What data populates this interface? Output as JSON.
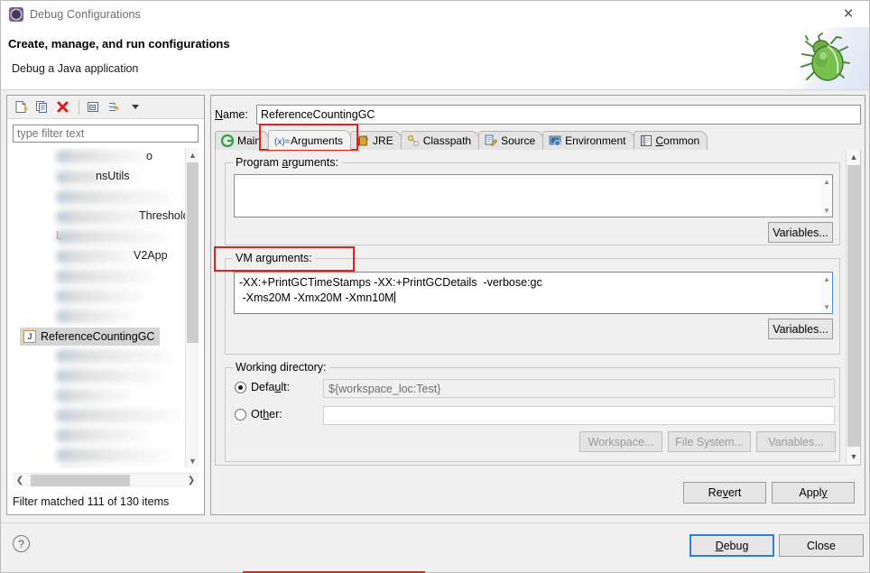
{
  "window": {
    "title": "Debug Configurations",
    "icon": "gear-icon",
    "close_label": "✕"
  },
  "header": {
    "title": "Create, manage, and run configurations",
    "subtitle": "Debug a Java application",
    "art_icon": "green-bug-icon"
  },
  "left_panel": {
    "toolbar": [
      {
        "name": "new-configuration-icon",
        "tooltip": "New launch configuration"
      },
      {
        "name": "duplicate-configuration-icon",
        "tooltip": "Duplicate"
      },
      {
        "name": "delete-configuration-icon",
        "tooltip": "Delete"
      },
      {
        "name": "collapse-all-icon",
        "tooltip": "Collapse All"
      },
      {
        "name": "filter-icon",
        "tooltip": "Filter launch configurations"
      },
      {
        "name": "view-menu-caret-icon",
        "tooltip": "View Menu"
      }
    ],
    "filter": {
      "value": "",
      "placeholder": "type filter text"
    },
    "tree": {
      "visible_fragments": [
        "o",
        "nsUtils",
        "Threshold",
        "L",
        "V2App"
      ],
      "selected_item": {
        "label": "ReferenceCountingGC",
        "icon": "java-application-icon",
        "icon_letter": "J"
      }
    },
    "status": "Filter matched 111 of 130 items"
  },
  "config": {
    "name_label": "Name:",
    "name_label_mnemonic": "N",
    "name_value": "ReferenceCountingGC",
    "tabs": [
      {
        "label": "Main",
        "icon": "main-tab-icon",
        "active": false,
        "mnemonic": ""
      },
      {
        "label": "Arguments",
        "icon": "arguments-tab-icon",
        "active": true,
        "mnemonic": ""
      },
      {
        "label": "JRE",
        "icon": "jre-tab-icon",
        "active": false,
        "mnemonic": ""
      },
      {
        "label": "Classpath",
        "icon": "classpath-tab-icon",
        "active": false,
        "mnemonic": ""
      },
      {
        "label": "Source",
        "icon": "source-tab-icon",
        "active": false,
        "mnemonic": ""
      },
      {
        "label": "Environment",
        "icon": "environment-tab-icon",
        "active": false,
        "mnemonic": ""
      },
      {
        "label": "Common",
        "icon": "common-tab-icon",
        "active": false,
        "mnemonic": "C"
      }
    ],
    "program_arguments": {
      "legend": "Program arguments:",
      "legend_mnemonic": "a",
      "value": "",
      "variables_button": "Variables..."
    },
    "vm_arguments": {
      "legend": "VM arguments:",
      "line1": "-XX:+PrintGCTimeStamps -XX:+PrintGCDetails  -verbose:gc",
      "line2": " -Xms20M -Xmx20M -Xmn10M",
      "variables_button": "Variables..."
    },
    "working_directory": {
      "legend": "Working directory:",
      "default_label": "Default:",
      "default_mnemonic": "u",
      "default_selected": true,
      "default_value": "${workspace_loc:Test}",
      "other_label": "Other:",
      "other_mnemonic": "h",
      "other_selected": false,
      "other_value": "",
      "workspace_button": "Workspace...",
      "filesystem_button": "File System...",
      "variables_button": "Variables..."
    },
    "revert_button": "Revert",
    "revert_mnemonic": "v",
    "apply_button": "Apply",
    "apply_mnemonic": "y"
  },
  "footer": {
    "help_icon": "?",
    "debug_button": "Debug",
    "debug_mnemonic": "D",
    "close_button": "Close"
  },
  "annotations": {
    "accent_color": "#ee1c15",
    "boxes": [
      "arguments-tab-highlight",
      "vm-arguments-label-highlight"
    ]
  }
}
